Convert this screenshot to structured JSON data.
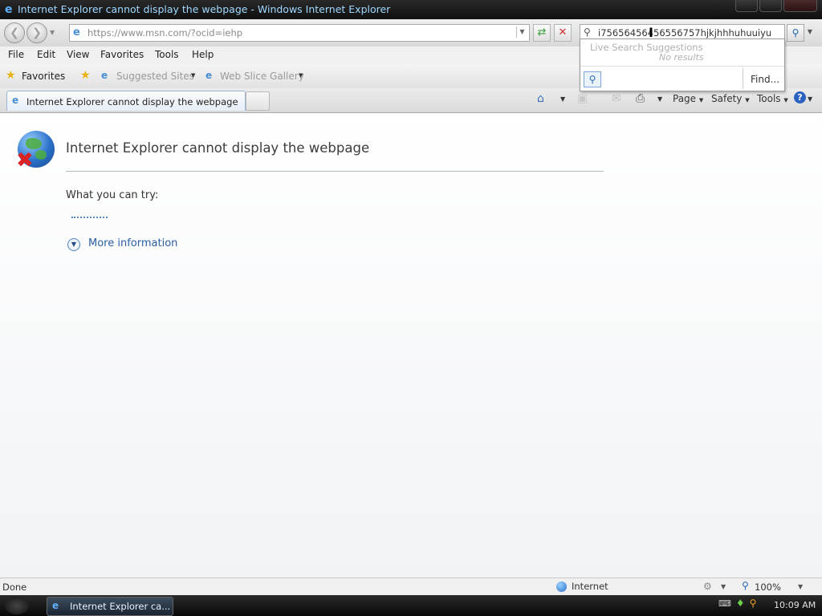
{
  "window": {
    "title": "Internet Explorer cannot display the webpage - Windows Internet Explorer"
  },
  "nav": {
    "address": "https://www.msn.com/?ocid=iehp",
    "search_text": "i75656456456556757hjkjhhhuhuuiyu"
  },
  "search_dropdown": {
    "header": "Live Search Suggestions",
    "no_results": "No results",
    "find_label": "Find..."
  },
  "menu": {
    "items": [
      "File",
      "Edit",
      "View",
      "Favorites",
      "Tools",
      "Help"
    ]
  },
  "favorites": {
    "label": "Favorites",
    "links": [
      "Suggested Sites",
      "Web Slice Gallery"
    ]
  },
  "tabs": [
    {
      "label": "Internet Explorer cannot display the webpage"
    }
  ],
  "command_bar": {
    "page": "Page",
    "safety": "Safety",
    "tools": "Tools"
  },
  "page": {
    "error_title": "Internet Explorer cannot display the webpage",
    "try_label": "What you can try:",
    "more_info": "More information"
  },
  "status": {
    "text": "Done",
    "zone": "Internet",
    "zoom": "100%"
  },
  "taskbar": {
    "task_label": "Internet Explorer ca...",
    "clock": "10:09 AM"
  }
}
